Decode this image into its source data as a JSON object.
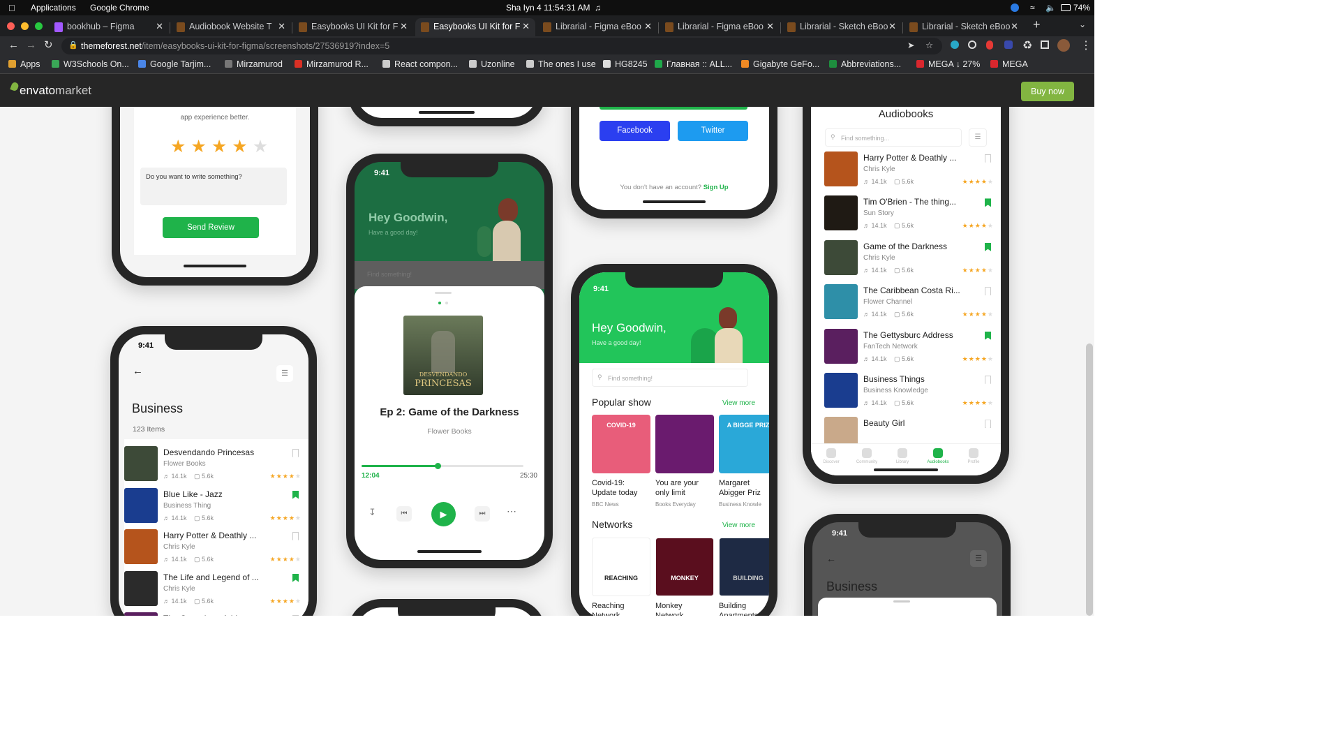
{
  "os_bar": {
    "apple": "",
    "menu": [
      "Applications",
      "Google Chrome"
    ],
    "clock": "Sha Iyn 4  11:54:31 AM",
    "battery": "74%"
  },
  "tabs": [
    {
      "label": "bookhub – Figma",
      "active": false
    },
    {
      "label": "Audiobook Website T",
      "active": false
    },
    {
      "label": "Easybooks UI Kit for F",
      "active": false
    },
    {
      "label": "Easybooks UI Kit for F",
      "active": true
    },
    {
      "label": "Librarial - Figma eBoo",
      "active": false
    },
    {
      "label": "Librarial - Figma eBoo",
      "active": false
    },
    {
      "label": "Librarial - Sketch eBoo",
      "active": false
    },
    {
      "label": "Librarial - Sketch eBoo",
      "active": false
    }
  ],
  "address": {
    "domain": "themeforest.net",
    "path": "/item/easybooks-ui-kit-for-figma/screenshots/27536919?index=5"
  },
  "bookmarks": [
    {
      "label": "Apps",
      "color": "#e0a030"
    },
    {
      "label": "W3Schools On...",
      "color": "#3aa757"
    },
    {
      "label": "Google Tarjim...",
      "color": "#4a86e8"
    },
    {
      "label": "Mirzamurod",
      "color": "#777777"
    },
    {
      "label": "Mirzamurod R...",
      "color": "#d93025"
    },
    {
      "label": "React compon...",
      "color": "#cccccc"
    },
    {
      "label": "Uzonline",
      "color": "#cccccc"
    },
    {
      "label": "The ones I use",
      "color": "#cccccc"
    },
    {
      "label": "HG8245",
      "color": "#dddddd"
    },
    {
      "label": "Главная :: ALL...",
      "color": "#1fa84a"
    },
    {
      "label": "Gigabyte GeFo...",
      "color": "#f08a24"
    },
    {
      "label": "Abbreviations...",
      "color": "#1e8e3e"
    },
    {
      "label": "MEGA ↓ 27%",
      "color": "#d9272e"
    },
    {
      "label": "MEGA",
      "color": "#d9272e"
    }
  ],
  "envato": {
    "logo": "envato",
    "logo2": "market",
    "buy_now": "Buy now"
  },
  "review_phone": {
    "text": "app experience better.",
    "rating": 4,
    "max_rating": 5,
    "placeholder": "Do you want to write something?",
    "button": "Send Review"
  },
  "login_phone": {
    "facebook": "Facebook",
    "twitter": "Twitter",
    "no_account": "You don't have an account?",
    "signup": "Sign Up"
  },
  "player_phone": {
    "time": "9:41",
    "greeting": "Hey Goodwin,",
    "sub": "Have a good day!",
    "search": "Find something!",
    "cover_line1": "DESVENDANDO",
    "cover_line2": "PRINCESAS",
    "title": "Ep 2: Game of the Darkness",
    "author": "Flower Books",
    "elapsed": "12:04",
    "duration": "25:30",
    "progress": 0.47
  },
  "home_phone": {
    "time": "9:41",
    "greeting": "Hey Goodwin,",
    "sub": "Have a good day!",
    "search": "Find something!",
    "popular": "Popular show",
    "view_more": "View more",
    "networks": "Networks",
    "shows": [
      {
        "title1": "Covid-19:",
        "title2": "Update today",
        "sub": "BBC News",
        "cover": "COVID-19"
      },
      {
        "title1": "You are your",
        "title2": "only limit",
        "sub": "Books Everyday",
        "cover": ""
      },
      {
        "title1": "Margaret",
        "title2": "Abigger Priz",
        "sub": "Business Knowle",
        "cover": "A BIGGE PRIZ"
      }
    ],
    "nets": [
      {
        "title1": "Reaching",
        "title2": "Network",
        "cover": "REACHING"
      },
      {
        "title1": "Monkey",
        "title2": "Network",
        "cover": "MONKEY"
      },
      {
        "title1": "Building",
        "title2": "Apartments",
        "cover": "BUILDING"
      }
    ]
  },
  "business_phone": {
    "time": "9:41",
    "title": "Business",
    "count": "123 Items",
    "items": [
      {
        "title": "Desvendando Princesas",
        "author": "Flower Books",
        "plays": "14.1k",
        "saves": "5.6k",
        "saved": false,
        "color": "#3d4a38"
      },
      {
        "title": "Blue Like - Jazz",
        "author": "Business Thing",
        "plays": "14.1k",
        "saves": "5.6k",
        "saved": true,
        "color": "#1a3d8f"
      },
      {
        "title": "Harry Potter & Deathly ...",
        "author": "Chris Kyle",
        "plays": "14.1k",
        "saves": "5.6k",
        "saved": false,
        "color": "#b5541c"
      },
      {
        "title": "The Life and Legend of ...",
        "author": "Chris Kyle",
        "plays": "14.1k",
        "saves": "5.6k",
        "saved": true,
        "color": "#2b2b2b"
      },
      {
        "title": "The Gettysburc Address",
        "author": "",
        "plays": "",
        "saves": "",
        "saved": false,
        "color": "#5a1f5f"
      }
    ]
  },
  "audiobooks_phone": {
    "title": "Audiobooks",
    "search": "Find something...",
    "items": [
      {
        "title": "Harry Potter & Deathly ...",
        "author": "Chris Kyle",
        "plays": "14.1k",
        "saves": "5.6k",
        "saved": false,
        "color": "#b5541c"
      },
      {
        "title": "Tim O'Brien - The thing...",
        "author": "Sun Story",
        "plays": "14.1k",
        "saves": "5.6k",
        "saved": true,
        "color": "#1f1a14"
      },
      {
        "title": "Game of the Darkness",
        "author": "Chris Kyle",
        "plays": "14.1k",
        "saves": "5.6k",
        "saved": true,
        "color": "#3d4a38"
      },
      {
        "title": "The Caribbean Costa Ri...",
        "author": "Flower Channel",
        "plays": "14.1k",
        "saves": "5.6k",
        "saved": false,
        "color": "#2e8fa8"
      },
      {
        "title": "The Gettysburc Address",
        "author": "FanTech Network",
        "plays": "14.1k",
        "saves": "5.6k",
        "saved": true,
        "color": "#5a1f5f"
      },
      {
        "title": "Business Things",
        "author": "Business Knowledge",
        "plays": "14.1k",
        "saves": "5.6k",
        "saved": false,
        "color": "#1a3d8f"
      },
      {
        "title": "Beauty Girl",
        "author": "",
        "plays": "",
        "saves": "",
        "saved": false,
        "color": "#c9a98a"
      }
    ],
    "nav": [
      "Discover",
      "Community",
      "Library",
      "Audiobooks",
      "Profile"
    ]
  },
  "business_phone2": {
    "time": "9:41",
    "title": "Business"
  }
}
